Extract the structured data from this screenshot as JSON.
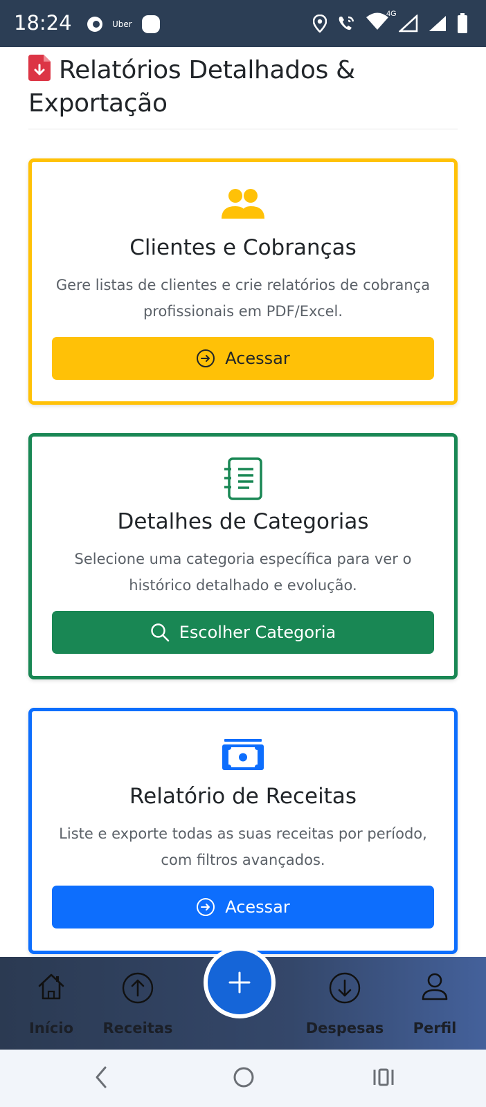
{
  "status_bar": {
    "time": "18:24",
    "app_label": "Uber",
    "network": "4G",
    "icons": [
      "notification-icon",
      "uber-icon",
      "app-icon",
      "location-icon",
      "wifi-calling-icon",
      "wifi-icon",
      "signal-icon",
      "signal-icon",
      "battery-icon"
    ]
  },
  "header": {
    "title": "Relatórios Detalhados & Exportação",
    "icon": "pdf-file-icon",
    "icon_color": "#dc3545"
  },
  "cards": [
    {
      "id": "clientes",
      "icon": "people-icon",
      "color": "#ffc107",
      "title": "Clientes e Cobranças",
      "description": "Gere listas de clientes e crie relatórios de cobrança profissionais em PDF/Excel.",
      "button_label": "Acessar",
      "button_icon": "arrow-right-circle-icon"
    },
    {
      "id": "categorias",
      "icon": "journal-list-icon",
      "color": "#198754",
      "title": "Detalhes de Categorias",
      "description": "Selecione uma categoria específica para ver o histórico detalhado e evolução.",
      "button_label": "Escolher Categoria",
      "button_icon": "search-icon"
    },
    {
      "id": "receitas",
      "icon": "cash-icon",
      "color": "#0d6efd",
      "title": "Relatório de Receitas",
      "description": "Liste e exporte todas as suas receitas por período, com filtros avançados.",
      "button_label": "Acessar",
      "button_icon": "arrow-right-circle-icon"
    }
  ],
  "bottom_nav": {
    "items": [
      {
        "label": "Início",
        "icon": "house-icon"
      },
      {
        "label": "Receitas",
        "icon": "arrow-up-circle-icon"
      },
      {
        "label": "Despesas",
        "icon": "arrow-down-circle-icon"
      },
      {
        "label": "Perfil",
        "icon": "person-icon"
      }
    ],
    "fab_icon": "plus-icon",
    "fab_color": "#1565d8"
  },
  "system_nav": {
    "icons": [
      "back-icon",
      "home-icon",
      "recents-icon"
    ]
  }
}
